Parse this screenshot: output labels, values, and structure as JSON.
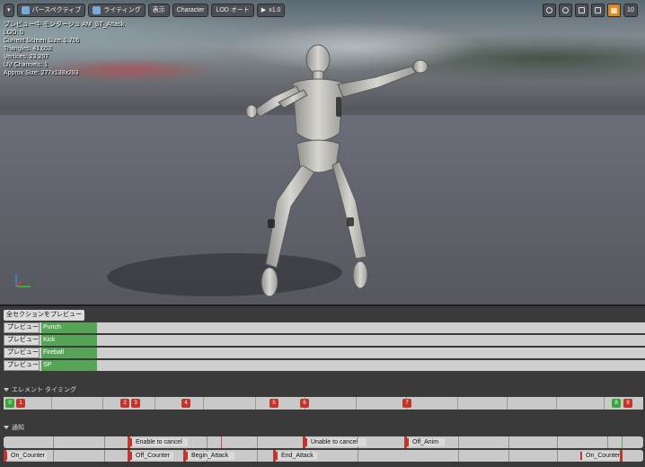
{
  "toolbar": {
    "left": [
      {
        "label": "",
        "icon": "dropdown-arrow-icon"
      },
      {
        "label": "パースペクティブ",
        "icon": "perspective-icon"
      },
      {
        "label": "ライティング",
        "icon": "lighting-icon"
      },
      {
        "label": "表示",
        "icon": ""
      },
      {
        "label": "Character",
        "icon": ""
      },
      {
        "label": "LOD オート",
        "icon": ""
      },
      {
        "label": "x1.0",
        "icon": "play-icon"
      }
    ],
    "right": {
      "camera_speed": "10"
    }
  },
  "stats": {
    "line1": "プレビュー中 モンタージュ AM_ST_Attack",
    "line2": "LOD: 0",
    "line3": "Current Screen Size: 1.706",
    "line4": "Triangles: 41,052",
    "line5": "Vertices: 23,297",
    "line6": "UV Channels: 1",
    "line7": "Approx Size: 277x138x283"
  },
  "montage": {
    "preview_all_label": "全セクションをプレビュー",
    "sections": [
      {
        "preview": "プレビュー",
        "name": "Punch"
      },
      {
        "preview": "プレビュー",
        "name": "Kick"
      },
      {
        "preview": "プレビュー",
        "name": "Fireball"
      },
      {
        "preview": "プレビュー",
        "name": "SP"
      }
    ],
    "timing_header": "エレメント タイミング",
    "timing_markers": [
      {
        "label": "0",
        "color": "green"
      },
      {
        "label": "1",
        "color": "red"
      },
      {
        "label": "2",
        "color": "red"
      },
      {
        "label": "3",
        "color": "red"
      },
      {
        "label": "4",
        "color": "red"
      },
      {
        "label": "5",
        "color": "red"
      },
      {
        "label": "6",
        "color": "red"
      },
      {
        "label": "7",
        "color": "red"
      },
      {
        "label": "8",
        "color": "green"
      },
      {
        "label": "9",
        "color": "red"
      }
    ],
    "notify_header": "通知",
    "notify_row1": [
      {
        "label": "Enable to cancel"
      },
      {
        "label": "Unable to cancel"
      },
      {
        "label": "Off_Anim"
      }
    ],
    "notify_row2": [
      {
        "label": "On_Counter"
      },
      {
        "label": "Off_Counter"
      },
      {
        "label": "Begin_Attack"
      },
      {
        "label": "End_Attack"
      },
      {
        "label": "On_Counter"
      }
    ]
  },
  "colors": {
    "section_green": "#56a556",
    "marker_red": "#c0362c",
    "marker_green": "#3aa53a",
    "accent_orange": "#d98a24"
  }
}
